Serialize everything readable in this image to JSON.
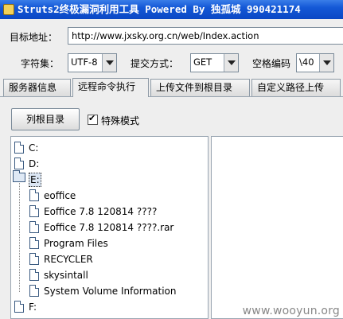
{
  "window": {
    "title": "Struts2终极漏洞利用工具  Powered By 独孤城 990421174"
  },
  "form": {
    "url_label": "目标地址：",
    "url_value": "http://www.jxsky.org.cn/web/Index.action",
    "charset_label": "字符集：",
    "charset_value": "UTF-8",
    "method_label": "提交方式：",
    "method_value": "GET",
    "space_label": "空格编码",
    "space_value": "\\40"
  },
  "tabs": [
    {
      "label": "服务器信息"
    },
    {
      "label": "远程命令执行"
    },
    {
      "label": "上传文件到根目录"
    },
    {
      "label": "自定义路径上传"
    }
  ],
  "panel": {
    "list_root_button": "列根目录",
    "special_mode_label": "特殊模式",
    "special_mode_checked": true
  },
  "tree": {
    "drives": [
      {
        "label": "C:"
      },
      {
        "label": "D:"
      },
      {
        "label": "E:"
      },
      {
        "label": "F:"
      }
    ],
    "e_children": [
      {
        "label": "eoffice"
      },
      {
        "label": "Eoffice 7.8 120814 ????"
      },
      {
        "label": "Eoffice 7.8 120814 ????.rar"
      },
      {
        "label": "Program Files"
      },
      {
        "label": "RECYCLER"
      },
      {
        "label": "skysintall"
      },
      {
        "label": "System Volume Information"
      }
    ]
  },
  "watermark": "www.wooyun.org",
  "icons": {
    "app": "java-cup-icon",
    "file": "file-icon",
    "folder": "folder-open-icon",
    "dropdown": "chevron-down-icon"
  },
  "colors": {
    "titlebar": "#0a47c4",
    "background": "#eeeeee"
  }
}
